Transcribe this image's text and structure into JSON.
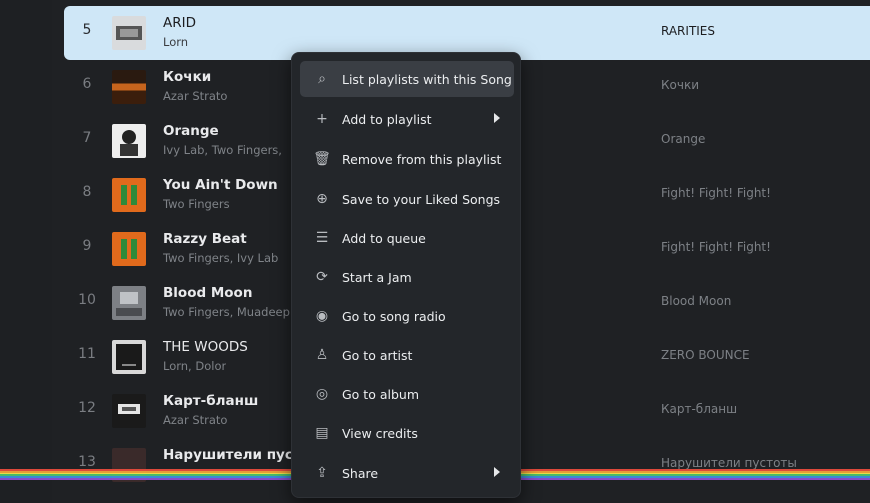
{
  "tracks": [
    {
      "num": "5",
      "title": "ARID",
      "artist": "Lorn",
      "album": "RARITIES",
      "art": "#6b6e72"
    },
    {
      "num": "6",
      "title": "Кочки",
      "artist": "Azar Strato",
      "album": "Кочки",
      "art": "#b85a1e"
    },
    {
      "num": "7",
      "title": "Orange",
      "artist": "Ivy Lab, Two Fingers,",
      "album": "Orange",
      "art": "#e8e8e8"
    },
    {
      "num": "8",
      "title": "You Ain't Down",
      "artist": "Two Fingers",
      "album": "Fight! Fight! Fight!",
      "art": "#e06a1c"
    },
    {
      "num": "9",
      "title": "Razzy Beat",
      "artist": "Two Fingers, Ivy Lab",
      "album": "Fight! Fight! Fight!",
      "art": "#e06a1c"
    },
    {
      "num": "10",
      "title": "Blood Moon",
      "artist": "Two Fingers, Muadeep",
      "album": "Blood Moon",
      "art": "#8a8d92"
    },
    {
      "num": "11",
      "title": "THE WOODS",
      "artist": "Lorn, Dolor",
      "album": "ZERO BOUNCE",
      "art": "#d8d8d8"
    },
    {
      "num": "12",
      "title": "Карт-бланш",
      "artist": "Azar Strato",
      "album": "Карт-бланш",
      "art": "#2a2a2a"
    },
    {
      "num": "13",
      "title": "Нарушители пустоты",
      "artist": "",
      "album": "Нарушители пустоты",
      "art": "#3a2a2a"
    }
  ],
  "menu": [
    {
      "icon": "⌕",
      "icon_name": "search-icon",
      "label": "List playlists with this Song"
    },
    {
      "icon": "+",
      "icon_name": "plus-icon",
      "label": "Add to playlist"
    },
    {
      "icon": "🗑",
      "icon_name": "trash-icon",
      "label": "Remove from this playlist"
    },
    {
      "icon": "⊕",
      "icon_name": "add-circle-icon",
      "label": "Save to your Liked Songs"
    },
    {
      "icon": "☰",
      "icon_name": "queue-icon",
      "label": "Add to queue"
    },
    {
      "icon": "⟳",
      "icon_name": "jam-icon",
      "label": "Start a Jam"
    },
    {
      "icon": "◉",
      "icon_name": "radio-icon",
      "label": "Go to song radio"
    },
    {
      "icon": "♙",
      "icon_name": "artist-icon",
      "label": "Go to artist"
    },
    {
      "icon": "◎",
      "icon_name": "album-icon",
      "label": "Go to album"
    },
    {
      "icon": "▤",
      "icon_name": "credits-icon",
      "label": "View credits"
    },
    {
      "icon": "⇪",
      "icon_name": "share-icon",
      "label": "Share"
    }
  ],
  "colors": {
    "selected_row": "#cfe7f7",
    "menu_bg": "#23262a",
    "menu_hover": "#3a3e44"
  }
}
